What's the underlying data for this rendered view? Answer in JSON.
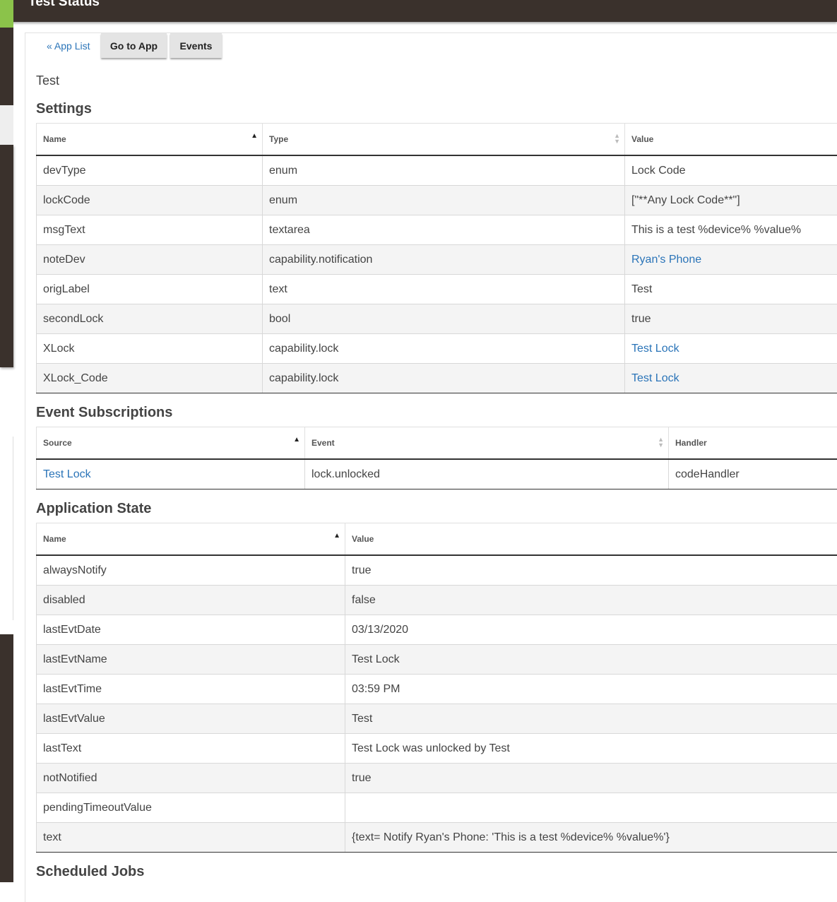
{
  "header": {
    "title": "Test Status"
  },
  "nav": {
    "app_list": "« App List",
    "go_to_app": "Go to App",
    "events": "Events"
  },
  "app_name": "Test",
  "settings": {
    "title": "Settings",
    "columns": [
      "Name",
      "Type",
      "Value"
    ],
    "rows": [
      {
        "name": "devType",
        "type": "enum",
        "value": "Lock Code",
        "link": false
      },
      {
        "name": "lockCode",
        "type": "enum",
        "value": "[\"**Any Lock Code**\"]",
        "link": false
      },
      {
        "name": "msgText",
        "type": "textarea",
        "value": "This is a test %device% %value%",
        "link": false
      },
      {
        "name": "noteDev",
        "type": "capability.notification",
        "value": "Ryan's Phone",
        "link": true
      },
      {
        "name": "origLabel",
        "type": "text",
        "value": "Test",
        "link": false
      },
      {
        "name": "secondLock",
        "type": "bool",
        "value": "true",
        "link": false
      },
      {
        "name": "XLock",
        "type": "capability.lock",
        "value": "Test Lock",
        "link": true
      },
      {
        "name": "XLock_Code",
        "type": "capability.lock",
        "value": "Test Lock",
        "link": true
      }
    ]
  },
  "subscriptions": {
    "title": "Event Subscriptions",
    "columns": [
      "Source",
      "Event",
      "Handler"
    ],
    "rows": [
      {
        "source": "Test Lock",
        "event": "lock.unlocked",
        "handler": "codeHandler"
      }
    ]
  },
  "app_state": {
    "title": "Application State",
    "columns": [
      "Name",
      "Value"
    ],
    "rows": [
      {
        "name": "alwaysNotify",
        "value": "true"
      },
      {
        "name": "disabled",
        "value": "false"
      },
      {
        "name": "lastEvtDate",
        "value": "03/13/2020"
      },
      {
        "name": "lastEvtName",
        "value": "Test Lock"
      },
      {
        "name": "lastEvtTime",
        "value": "03:59 PM"
      },
      {
        "name": "lastEvtValue",
        "value": "Test"
      },
      {
        "name": "lastText",
        "value": "Test Lock was unlocked by Test"
      },
      {
        "name": "notNotified",
        "value": "true"
      },
      {
        "name": "pendingTimeoutValue",
        "value": ""
      },
      {
        "name": "text",
        "value": "{text= Notify Ryan's Phone: 'This is a test %device% %value%'}"
      }
    ]
  },
  "scheduled_jobs": {
    "title": "Scheduled Jobs"
  },
  "colors": {
    "topbar": "#3a312c",
    "accent": "#8bc34a",
    "link": "#2a74b8"
  },
  "icons": {
    "sort_ascending": "sort-asc-icon",
    "sort_unsorted": "sort-both-icon"
  }
}
